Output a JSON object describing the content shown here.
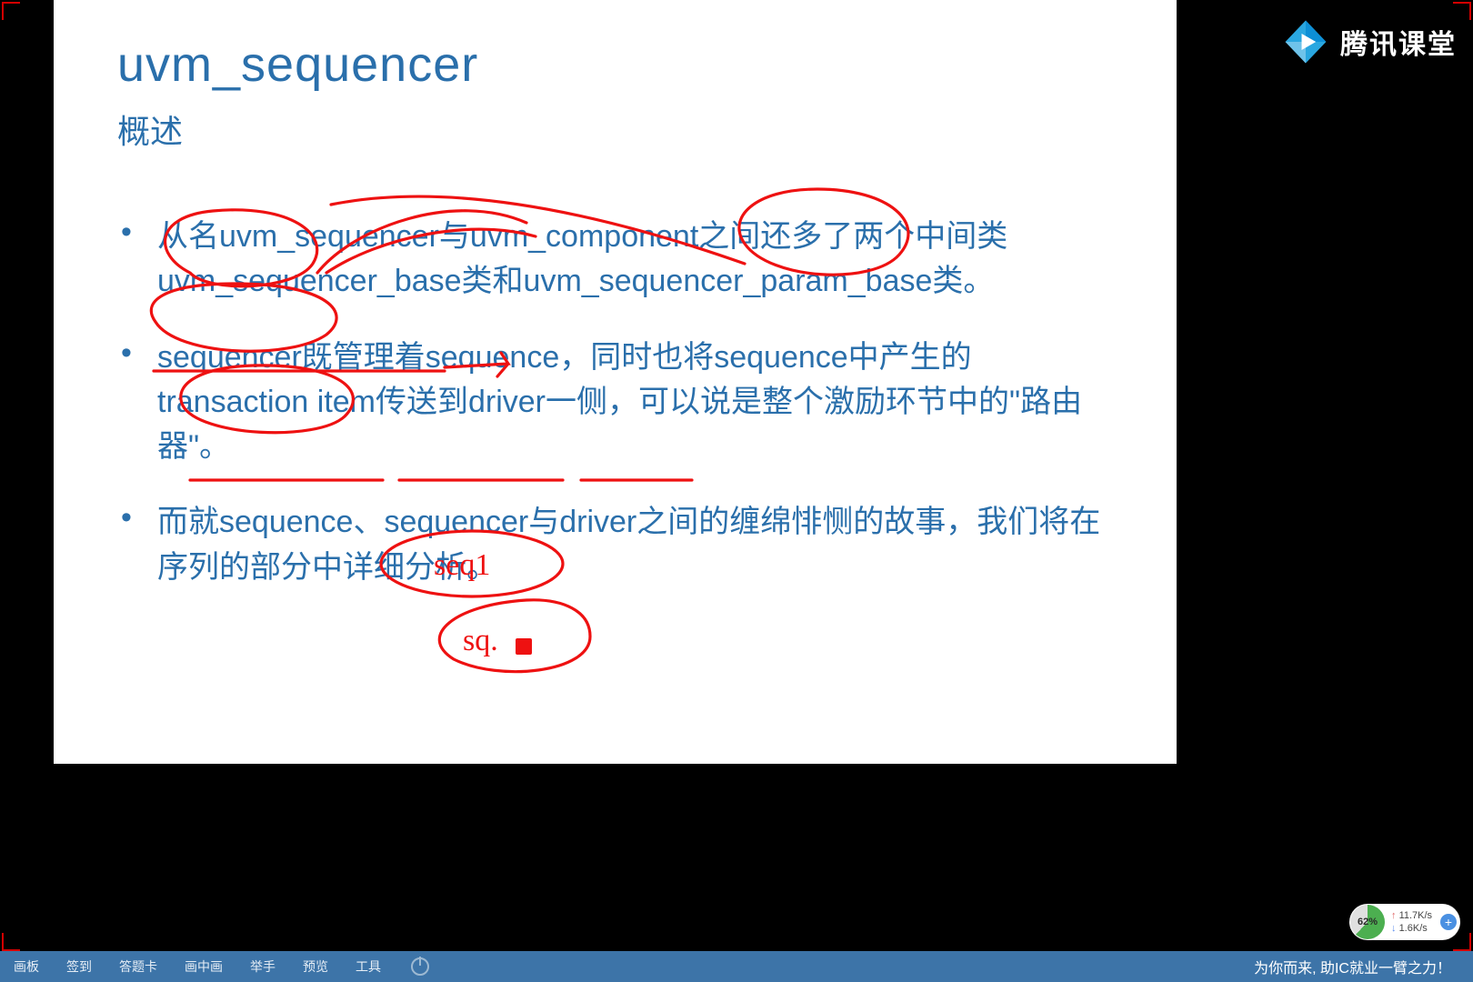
{
  "logo_text": "腾讯课堂",
  "slide": {
    "title": "uvm_sequencer",
    "subtitle": "概述",
    "bullets": [
      "从名uvm_sequencer与uvm_component之间还多了两个中间类uvm_sequencer_base类和uvm_sequencer_param_base类。",
      "sequencer既管理着sequence，同时也将sequence中产生的transaction item传送到driver一侧，可以说是整个激励环节中的\"路由器\"。",
      "而就sequence、sequencer与driver之间的缠绵悱恻的故事，我们将在序列的部分中详细分析。"
    ],
    "handwritten": [
      "seq1",
      "sq."
    ]
  },
  "toolbar": {
    "items": [
      "画板",
      "签到",
      "答题卡",
      "画中画",
      "举手",
      "预览",
      "工具"
    ],
    "tagline": "为你而来, 助IC就业一臂之力！"
  },
  "net": {
    "percent": "62%",
    "up": "11.7K/s",
    "down": "1.6K/s"
  }
}
